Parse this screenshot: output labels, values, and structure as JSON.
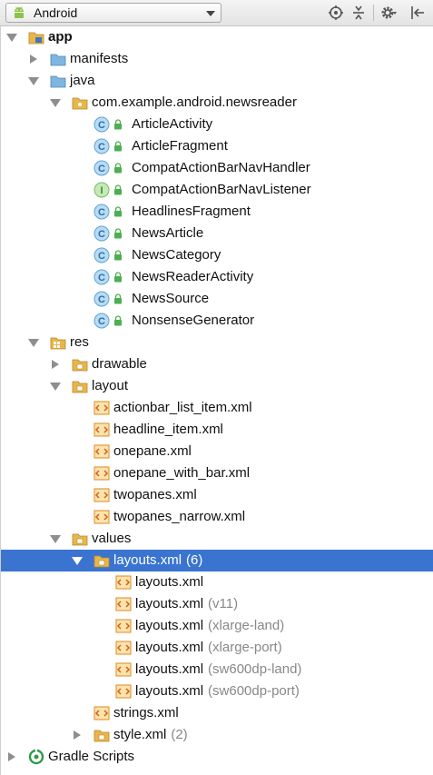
{
  "toolbar": {
    "view_label": "Android",
    "icons": [
      "android-icon",
      "sync-target-icon",
      "collapse-all-icon",
      "gear-icon",
      "hide-panel-icon"
    ]
  },
  "colors": {
    "selection": "#3a74d0",
    "folder": "#e9b64a",
    "class_badge": "#5ba3d7",
    "interface_badge": "#73bf5b",
    "lock": "#4caf50",
    "qualifier": "#888888"
  },
  "tree": {
    "app": {
      "label": "app"
    },
    "manifests": {
      "label": "manifests"
    },
    "java": {
      "label": "java"
    },
    "package": {
      "label": "com.example.android.newsreader"
    },
    "classes": [
      {
        "label": "ArticleActivity",
        "badge": "C"
      },
      {
        "label": "ArticleFragment",
        "badge": "C"
      },
      {
        "label": "CompatActionBarNavHandler",
        "badge": "C"
      },
      {
        "label": "CompatActionBarNavListener",
        "badge": "I"
      },
      {
        "label": "HeadlinesFragment",
        "badge": "C"
      },
      {
        "label": "NewsArticle",
        "badge": "C"
      },
      {
        "label": "NewsCategory",
        "badge": "C"
      },
      {
        "label": "NewsReaderActivity",
        "badge": "C"
      },
      {
        "label": "NewsSource",
        "badge": "C"
      },
      {
        "label": "NonsenseGenerator",
        "badge": "C"
      }
    ],
    "res": {
      "label": "res"
    },
    "drawable": {
      "label": "drawable"
    },
    "layout": {
      "label": "layout"
    },
    "layout_files": [
      {
        "label": "actionbar_list_item.xml"
      },
      {
        "label": "headline_item.xml"
      },
      {
        "label": "onepane.xml"
      },
      {
        "label": "onepane_with_bar.xml"
      },
      {
        "label": "twopanes.xml"
      },
      {
        "label": "twopanes_narrow.xml"
      }
    ],
    "values": {
      "label": "values"
    },
    "layouts_group": {
      "label": "layouts.xml",
      "count": "(6)"
    },
    "layouts_files": [
      {
        "label": "layouts.xml",
        "qualifier": ""
      },
      {
        "label": "layouts.xml",
        "qualifier": "(v11)"
      },
      {
        "label": "layouts.xml",
        "qualifier": "(xlarge-land)"
      },
      {
        "label": "layouts.xml",
        "qualifier": "(xlarge-port)"
      },
      {
        "label": "layouts.xml",
        "qualifier": "(sw600dp-land)"
      },
      {
        "label": "layouts.xml",
        "qualifier": "(sw600dp-port)"
      }
    ],
    "strings": {
      "label": "strings.xml"
    },
    "style": {
      "label": "style.xml",
      "count": "(2)"
    },
    "gradle": {
      "label": "Gradle Scripts"
    }
  }
}
